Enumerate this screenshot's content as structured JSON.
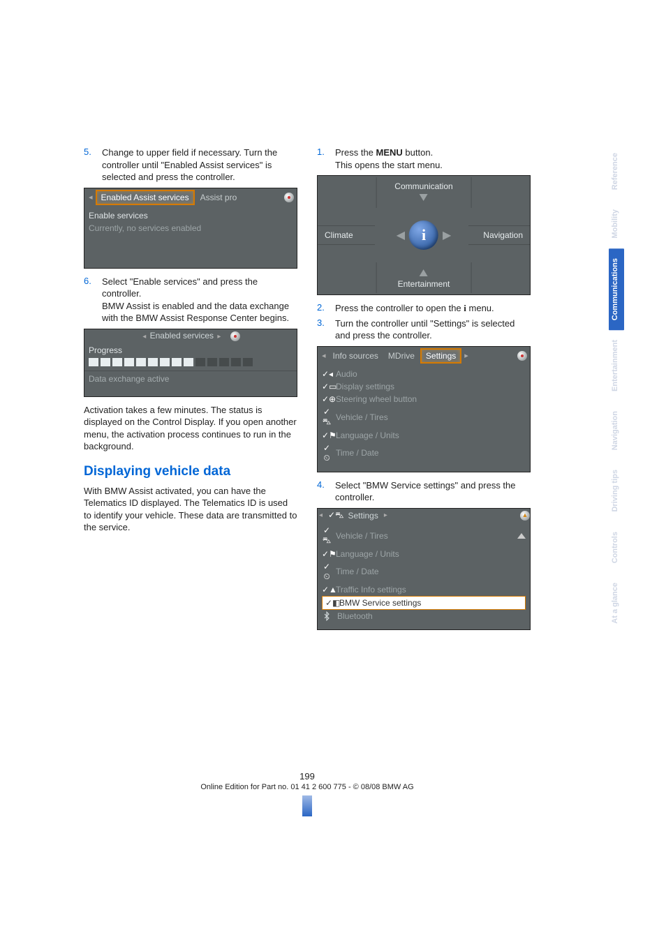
{
  "left": {
    "step5_num": "5.",
    "step5_text": "Change to upper field if necessary. Turn the controller until \"Enabled Assist services\" is selected and press the controller.",
    "shot1": {
      "tab_active": "Enabled Assist services",
      "tab_other": "Assist pro",
      "line1": "Enable services",
      "line2": "Currently, no services enabled"
    },
    "step6_num": "6.",
    "step6_text": "Select \"Enable services\" and press the controller.",
    "step6_more": "BMW Assist is enabled and the data exchange with the BMW Assist Response Center begins.",
    "shot2": {
      "head_left_arrow": "◂",
      "head_title": "Enabled services",
      "head_right_arrow": "▸",
      "progress_label": "Progress",
      "progress_filled": 9,
      "progress_total": 14,
      "status": "Data exchange active"
    },
    "after": "Activation takes a few minutes. The status is displayed on the Control Display. If you open another menu, the activation process continues to run in the background.",
    "heading": "Displaying vehicle data",
    "heading_text": "With BMW Assist activated, you can have the Telematics ID displayed. The Telematics ID is used to identify your vehicle. These data are transmitted to the service."
  },
  "right": {
    "step1_num": "1.",
    "step1_text_a": "Press the ",
    "step1_text_menu": "MENU",
    "step1_text_b": " button.",
    "step1_text2": "This opens the start menu.",
    "startmenu": {
      "top": "Communication",
      "left": "Climate",
      "right": "Navigation",
      "bottom": "Entertainment",
      "center": "i"
    },
    "step2_num": "2.",
    "step2_text_a": "Press the controller to open the ",
    "step2_text_i": "i",
    "step2_text_b": " menu.",
    "step3_num": "3.",
    "step3_text": "Turn the controller until \"Settings\" is selected and press the controller.",
    "shot_settings_tabs": {
      "t1": "Info sources",
      "t2": "MDrive",
      "t3": "Settings"
    },
    "shot_settings_list": [
      "Audio",
      "Display settings",
      "Steering wheel button",
      "Vehicle / Tires",
      "Language / Units",
      "Time / Date"
    ],
    "step4_num": "4.",
    "step4_text": "Select \"BMW Service settings\" and press the controller.",
    "shot_settings2_head": "Settings",
    "shot_settings2_list": [
      "Vehicle / Tires",
      "Language / Units",
      "Time / Date",
      "Traffic Info settings"
    ],
    "shot_settings2_selected": "BMW Service settings",
    "shot_settings2_bluetooth": "Bluetooth"
  },
  "sidetabs": [
    "Reference",
    "Mobility",
    "Communications",
    "Entertainment",
    "Navigation",
    "Driving tips",
    "Controls",
    "At a glance"
  ],
  "sidetabs_active_index": 2,
  "footer": {
    "page": "199",
    "edition": "Online Edition for Part no. 01 41 2 600 775 - © 08/08 BMW AG"
  }
}
